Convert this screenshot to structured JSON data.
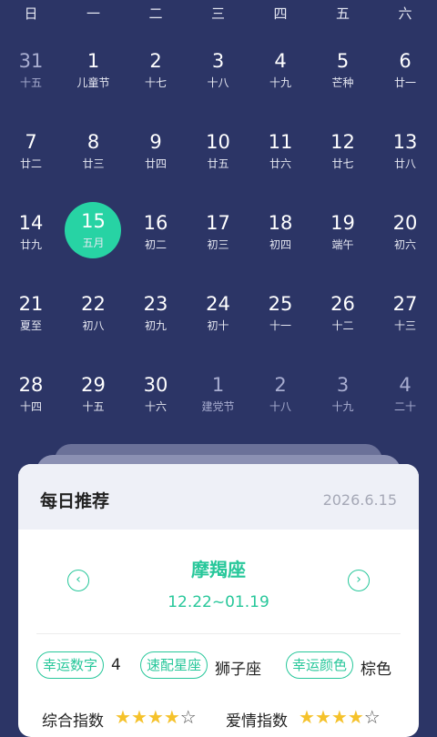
{
  "weekdays": [
    "日",
    "一",
    "二",
    "三",
    "四",
    "五",
    "六"
  ],
  "weeks": [
    [
      {
        "n": "31",
        "s": "十五",
        "m": true
      },
      {
        "n": "1",
        "s": "儿童节"
      },
      {
        "n": "2",
        "s": "十七"
      },
      {
        "n": "3",
        "s": "十八"
      },
      {
        "n": "4",
        "s": "十九"
      },
      {
        "n": "5",
        "s": "芒种"
      },
      {
        "n": "6",
        "s": "廿一"
      }
    ],
    [
      {
        "n": "7",
        "s": "廿二"
      },
      {
        "n": "8",
        "s": "廿三"
      },
      {
        "n": "9",
        "s": "廿四"
      },
      {
        "n": "10",
        "s": "廿五"
      },
      {
        "n": "11",
        "s": "廿六"
      },
      {
        "n": "12",
        "s": "廿七"
      },
      {
        "n": "13",
        "s": "廿八"
      }
    ],
    [
      {
        "n": "14",
        "s": "廿九"
      },
      {
        "n": "15",
        "s": "五月",
        "sel": true
      },
      {
        "n": "16",
        "s": "初二"
      },
      {
        "n": "17",
        "s": "初三"
      },
      {
        "n": "18",
        "s": "初四"
      },
      {
        "n": "19",
        "s": "端午"
      },
      {
        "n": "20",
        "s": "初六"
      }
    ],
    [
      {
        "n": "21",
        "s": "夏至"
      },
      {
        "n": "22",
        "s": "初八"
      },
      {
        "n": "23",
        "s": "初九"
      },
      {
        "n": "24",
        "s": "初十"
      },
      {
        "n": "25",
        "s": "十一"
      },
      {
        "n": "26",
        "s": "十二"
      },
      {
        "n": "27",
        "s": "十三"
      }
    ],
    [
      {
        "n": "28",
        "s": "十四"
      },
      {
        "n": "29",
        "s": "十五"
      },
      {
        "n": "30",
        "s": "十六"
      },
      {
        "n": "1",
        "s": "建党节",
        "m": true
      },
      {
        "n": "2",
        "s": "十八",
        "m": true
      },
      {
        "n": "3",
        "s": "十九",
        "m": true
      },
      {
        "n": "4",
        "s": "二十",
        "m": true
      }
    ]
  ],
  "colors": {
    "accent": "#27d3a4",
    "background": "#2c3566",
    "star": "#f5c22b"
  },
  "card": {
    "title": "每日推荐",
    "date": "2026.6.15",
    "prev_icon": "chevron-left-icon",
    "next_icon": "chevron-right-icon",
    "sign_name": "摩羯座",
    "sign_range": "12.22~01.19",
    "lucky_number_label": "幸运数字",
    "lucky_number": "4",
    "match_label": "速配星座",
    "match_value": "狮子座",
    "lucky_color_label": "幸运颜色",
    "lucky_color_value": "棕色",
    "overall_label": "综合指数",
    "overall_stars": 4,
    "love_label": "爱情指数",
    "love_stars": 4,
    "max_stars": 5
  }
}
